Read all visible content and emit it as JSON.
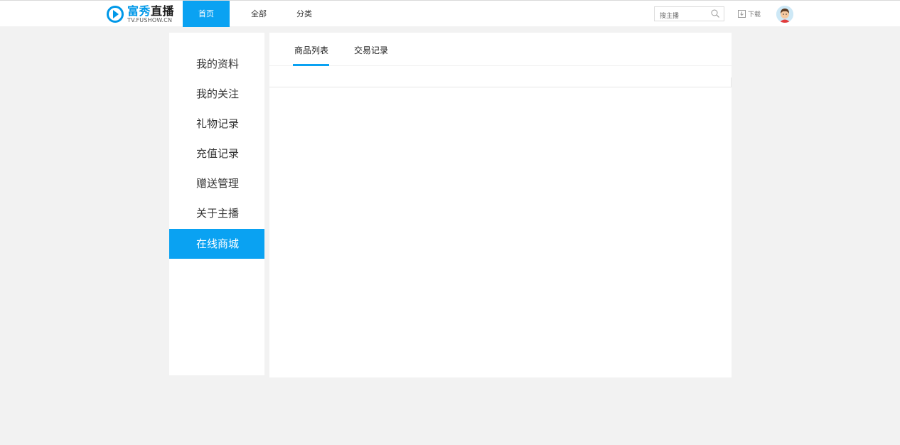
{
  "brand": {
    "title_part1": "富秀",
    "title_part2": "直播",
    "subtitle": "TV.FUSHOW.CN",
    "accent": "#0aa2f2"
  },
  "nav": {
    "home": "首页",
    "all": "全部",
    "category": "分类"
  },
  "search": {
    "placeholder": "搜主播"
  },
  "download": {
    "label": "下载"
  },
  "sidebar": {
    "items": [
      {
        "label": "我的资料"
      },
      {
        "label": "我的关注"
      },
      {
        "label": "礼物记录"
      },
      {
        "label": "充值记录"
      },
      {
        "label": "赠送管理"
      },
      {
        "label": "关于主播"
      },
      {
        "label": "在线商城"
      }
    ],
    "active_index": 6
  },
  "tabs": {
    "products": "商品列表",
    "trades": "交易记录",
    "active": "products"
  },
  "icons": {
    "search": "search-icon",
    "download": "download-icon",
    "logo": "play-logo-icon",
    "avatar": "user-avatar"
  }
}
